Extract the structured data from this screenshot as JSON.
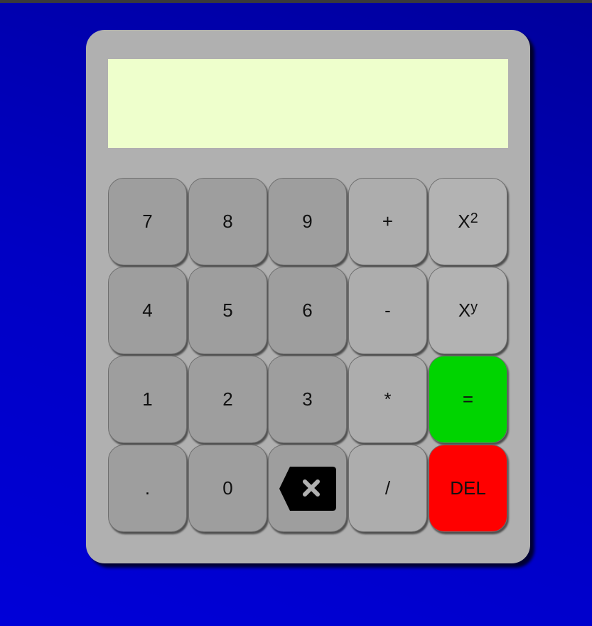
{
  "display": {
    "value": ""
  },
  "keys": {
    "k7": "7",
    "k8": "8",
    "k9": "9",
    "plus": "+",
    "sq_base": "X",
    "sq_exp": "2",
    "k4": "4",
    "k5": "5",
    "k6": "6",
    "minus": "-",
    "pow_base": "X",
    "pow_exp": "y",
    "k1": "1",
    "k2": "2",
    "k3": "3",
    "mul": "*",
    "eq": "=",
    "dot": ".",
    "k0": "0",
    "backspace_icon": "backspace-icon",
    "div": "/",
    "del": "DEL"
  },
  "colors": {
    "background": "#0000c8",
    "body": "#b0b0b0",
    "display": "#eeffcc",
    "digit_key": "#9e9e9e",
    "op_key": "#adadad",
    "equals_key": "#00d400",
    "delete_key": "#ff0000"
  }
}
